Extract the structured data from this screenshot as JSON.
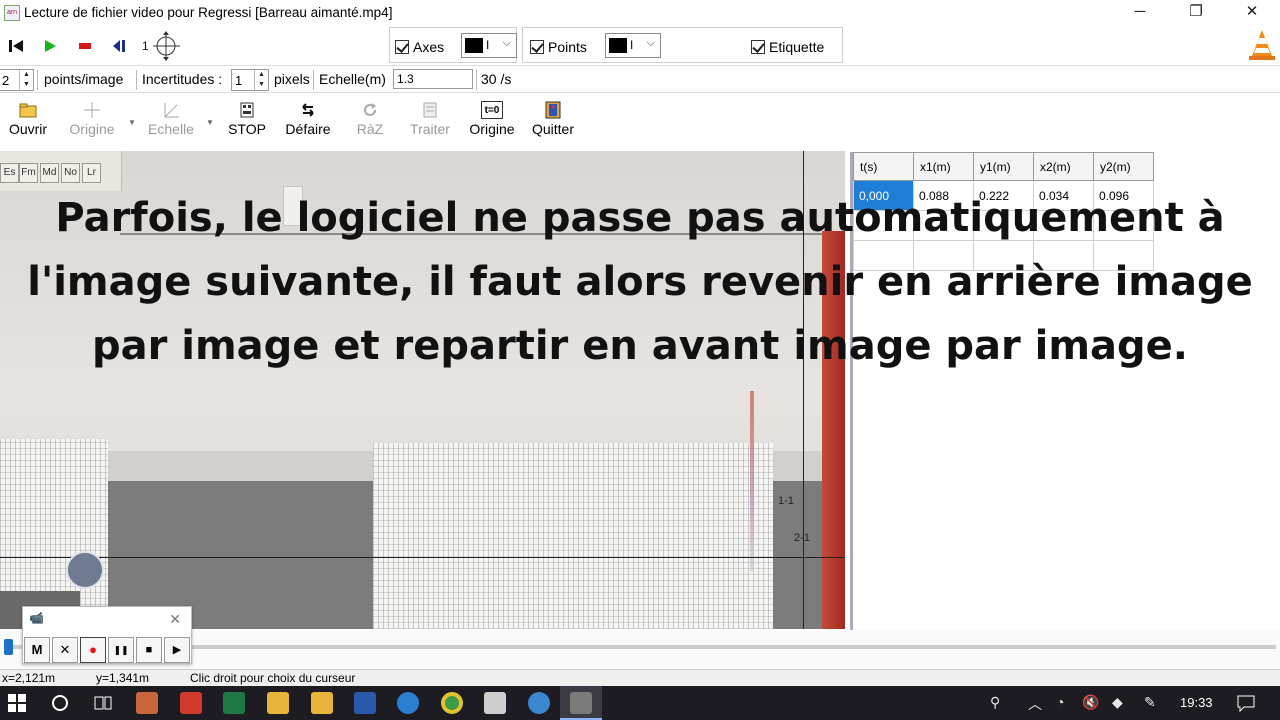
{
  "window": {
    "title": "Lecture de fichier video pour Regressi [Barreau aimanté.mp4]",
    "minimize_icon": "─",
    "maximize_icon": "❐",
    "close_icon": "✕"
  },
  "playback": {
    "first_icon": "skip-start-icon",
    "play_icon": "play-icon",
    "stop_icon": "stop-icon",
    "prev_icon": "step-back-icon",
    "target_label": "1"
  },
  "axes_group": {
    "label": "Axes",
    "checked": true,
    "color_text": "I",
    "color": "#000000"
  },
  "points_group": {
    "label": "Points",
    "checked": true,
    "color_text": "I",
    "color": "#000000"
  },
  "etiquette": {
    "label": "Etiquette",
    "checked": true
  },
  "params": {
    "points_per_image": "2",
    "points_label": "points/image",
    "uncertainty_label": "Incertitudes :",
    "uncertainty_value": "1",
    "pixels_label": "pixels",
    "scale_label": "Echelle(m)",
    "scale_value": "1.3",
    "fps_label": "30 /s"
  },
  "tools": [
    {
      "label": "Ouvrir",
      "icon": "folder-icon",
      "enabled": true
    },
    {
      "label": "Origine",
      "icon": "crosshair-icon",
      "enabled": false
    },
    {
      "label": "Echelle",
      "icon": "scale-icon",
      "enabled": false
    },
    {
      "label": "STOP",
      "icon": "stop-sign-icon",
      "enabled": true
    },
    {
      "label": "Défaire",
      "icon": "undo-icon",
      "enabled": true
    },
    {
      "label": "RàZ",
      "icon": "reset-icon",
      "enabled": false
    },
    {
      "label": "Traiter",
      "icon": "process-icon",
      "enabled": false
    },
    {
      "label": "Origine",
      "icon": "t0-icon",
      "icon_text": "t=0",
      "enabled": true
    },
    {
      "label": "Quitter",
      "icon": "exit-icon",
      "enabled": true
    }
  ],
  "video": {
    "periodic_cells": [
      "Es",
      "Fm",
      "Md",
      "No",
      "Lr"
    ],
    "point_labels": [
      "1-1",
      "2-1"
    ]
  },
  "caption": "Parfois, le logiciel ne passe pas automatiquement à l'image suivante, il faut alors revenir en arrière image par image et repartir en avant image par image.",
  "table": {
    "headers": [
      "t(s)",
      "x1(m)",
      "y1(m)",
      "x2(m)",
      "y2(m)"
    ],
    "rows": [
      [
        "0,000",
        "0.088",
        "0.222",
        "0.034",
        "0.096"
      ],
      [
        "",
        "",
        "",
        "",
        ""
      ],
      [
        "",
        "",
        "",
        "",
        ""
      ]
    ]
  },
  "timeline": {
    "position": 0.0
  },
  "recorder": {
    "buttons": [
      "M",
      "✕",
      "●",
      "❚❚",
      "■",
      "▶"
    ]
  },
  "status": {
    "x": "x=2,121m",
    "y": "y=1,341m",
    "hint": "Clic droit pour choix du curseur"
  },
  "taskbar": {
    "time": "19:33",
    "apps": [
      "windows-icon",
      "search-circle-icon",
      "task-view-icon",
      "media-icon",
      "pdf-icon",
      "excel-icon",
      "folder-icon",
      "word-icon",
      "teamviewer-icon",
      "chrome-icon",
      "recycle-icon",
      "word-online-icon",
      "regressi-icon"
    ],
    "app_colors": [
      "#ffffff",
      "#ffffff",
      "#ffffff",
      "#c9663b",
      "#d23b2b",
      "#1e7a44",
      "#e8b43a",
      "#2a5aa9",
      "#2b7fd0",
      "#3c9b46",
      "#cfcfcf",
      "#3a88d1",
      "#7a7a7a"
    ]
  }
}
